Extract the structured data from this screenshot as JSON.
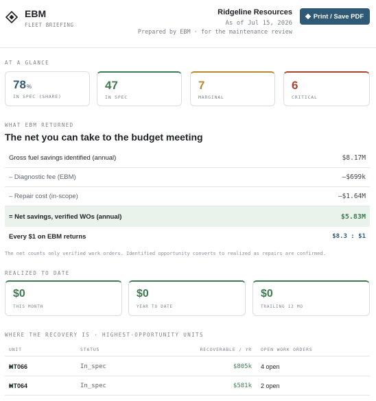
{
  "header": {
    "brand": "EBM",
    "subtitle": "FLEET BRIEFING",
    "org": "Ridgeline Resources",
    "as_of": "As of Jul 15, 2026",
    "prepared": "Prepared by EBM · for the maintenance review",
    "print_label": "Print / Save PDF",
    "logo_icon": "diamond-logo-icon"
  },
  "glance": {
    "label": "AT A GLANCE",
    "cards": [
      {
        "value": "78",
        "unit": "%",
        "label": "IN SPEC (SHARE)",
        "color": "#2f5974"
      },
      {
        "value": "47",
        "label": "IN SPEC",
        "color": "#3d7a4f"
      },
      {
        "value": "7",
        "label": "MARGINAL",
        "color": "#b8872d"
      },
      {
        "value": "6",
        "label": "CRITICAL",
        "color": "#a9432e"
      }
    ]
  },
  "returned": {
    "label": "WHAT EBM RETURNED",
    "heading": "The net you can take to the budget meeting",
    "rows": [
      {
        "label": "Gross fuel savings identified (annual)",
        "value": "$8.17M"
      },
      {
        "label": "– Diagnostic fee (EBM)",
        "value": "–$699k"
      },
      {
        "label": "– Repair cost (in-scope)",
        "value": "–$1.64M"
      },
      {
        "label": "= Net savings, verified WOs (annual)",
        "value": "$5.83M"
      },
      {
        "label": "Every $1 on EBM returns",
        "value": "$8.3 : $1"
      }
    ],
    "footnote": "The net counts only verified work orders. Identified opportunity converts to realized as repairs are confirmed."
  },
  "realized": {
    "label": "REALIZED TO DATE",
    "cards": [
      {
        "value": "$0",
        "label": "THIS MONTH"
      },
      {
        "value": "$0",
        "label": "YEAR TO DATE"
      },
      {
        "value": "$0",
        "label": "TRAILING 12 MO"
      }
    ]
  },
  "recovery": {
    "label": "WHERE THE RECOVERY IS · HIGHEST-OPPORTUNITY UNITS",
    "columns": [
      "UNIT",
      "STATUS",
      "RECOVERABLE / YR",
      "OPEN WORK ORDERS"
    ],
    "rows": [
      {
        "unit": "HT066",
        "status": "In_spec",
        "recoverable": "$805k",
        "work_orders": "4 open"
      },
      {
        "unit": "HT064",
        "status": "In_spec",
        "recoverable": "$581k",
        "work_orders": "2 open"
      }
    ]
  }
}
